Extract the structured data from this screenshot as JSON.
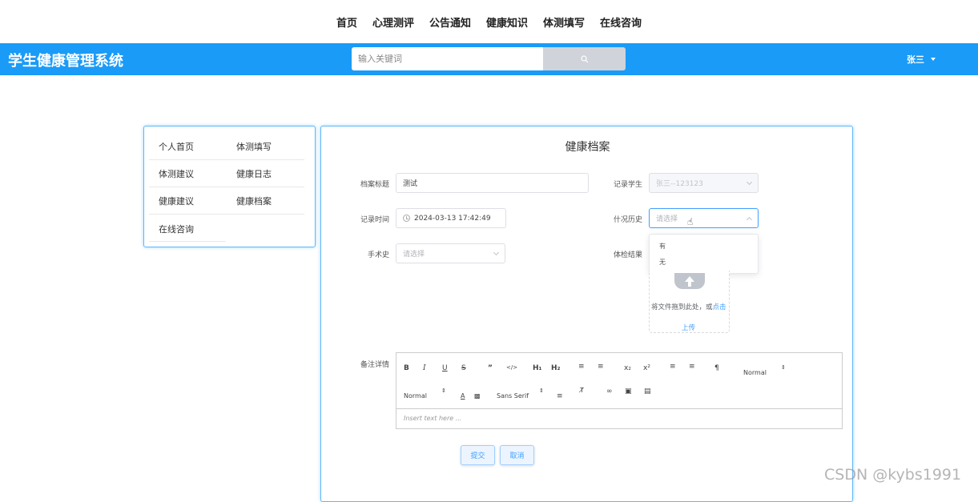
{
  "topnav": {
    "items": [
      "首页",
      "心理测评",
      "公告通知",
      "健康知识",
      "体测填写",
      "在线咨询"
    ]
  },
  "header": {
    "brand": "学生健康管理系统",
    "search_placeholder": "输入关键词",
    "user": "张三"
  },
  "sidebar": {
    "items": [
      "个人首页",
      "体测填写",
      "体测建议",
      "健康日志",
      "健康建议",
      "健康档案",
      "在线咨询"
    ]
  },
  "form": {
    "title": "健康档案",
    "title_label": "档案标题",
    "title_value": "测试",
    "student_label": "记录学生",
    "student_value": "张三--123123",
    "time_label": "记录时间",
    "time_value": "2024-03-13 17:42:49",
    "history_label": "什况历史",
    "history_placeholder": "请选择",
    "history_options": [
      "有",
      "无"
    ],
    "surgery_label": "手术史",
    "surgery_placeholder": "请选择",
    "result_label": "体检结果",
    "upload_text": "将文件拖到此处，或",
    "upload_link": "点击",
    "upload_link2": "上传",
    "notes_label": "备注详情",
    "editor": {
      "header_select": "Normal",
      "size_select": "Normal",
      "font_select": "Sans Serif",
      "placeholder": "Insert text here ..."
    },
    "submit_label": "提交",
    "cancel_label": "取消"
  },
  "watermark": "CSDN @kybs1991",
  "colors": {
    "header_bg": "#1a9bf7",
    "accent": "#409eff"
  }
}
